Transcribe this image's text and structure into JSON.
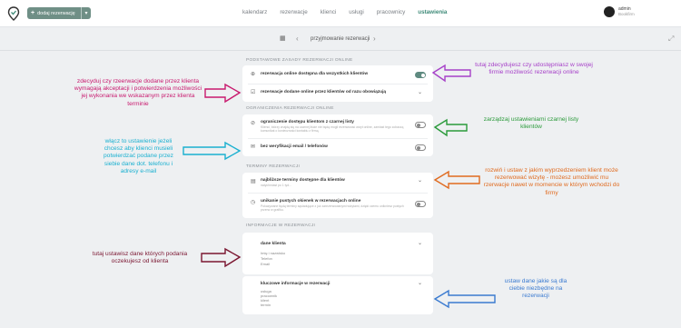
{
  "header": {
    "add_button_label": "dodaj rezerwację",
    "nav": [
      {
        "label": "kalendarz",
        "active": false
      },
      {
        "label": "rezerwacje",
        "active": false
      },
      {
        "label": "klienci",
        "active": false
      },
      {
        "label": "usługi",
        "active": false
      },
      {
        "label": "pracownicy",
        "active": false
      },
      {
        "label": "ustawienia",
        "active": true
      }
    ],
    "user_name": "admin",
    "user_company": "Bookfirm"
  },
  "subbar": {
    "title": "przyjmowanie rezerwacji"
  },
  "sections": {
    "basic": {
      "heading": "PODSTAWOWE ZASADY REZERWACJI ONLINE",
      "row1_label": "rezerwacja online dostępna dla wszystkich klientów",
      "row2_label": "rezerwacje dodane online przez klientów od razu obowiązują"
    },
    "restrictions": {
      "heading": "OGRANICZENIA REZERWACJI ONLINE",
      "row1_label": "ograniczenie dostępu klientom z czarnej listy",
      "row1_desc": "Klienci, którzy znajdą się na czarnej liście nie będą mogli rezerwować wizyt online, zamiast tego zobaczą komunikat o konieczności kontaktu z firmą.",
      "row2_label": "bez weryfikacji email / telefonów"
    },
    "terms": {
      "heading": "TERMINY REZERWACJI",
      "row1_label": "najbliższe terminy dostępne dla klientów",
      "row1_desc": "natychmiast po 1 tyd...",
      "row2_label": "unikanie pustych okienek w rezerwacjach online",
      "row2_desc": "Pokazywane będą terminy sąsiadujące z już zarezerwowanymi wizytami, dzięki czemu unikniesz pustych przerw w grafiku."
    },
    "info": {
      "heading": "INFORMACJE W REZERWACJI",
      "client_data_label": "dane klienta",
      "client_data_items": [
        "Imię i nazwisko",
        "Telefon",
        "Email"
      ],
      "key_info_label": "kluczowe informacje w rezerwacji",
      "key_info_items": [
        "usługa",
        "pracownik",
        "klient",
        "termin"
      ]
    }
  },
  "annotations": {
    "a1": "tutaj zdecydujesz czy udostępniasz w swojej firmie możliwość rezerwacji online",
    "a2": "zdecyduj czy rzeerwacje dodane przez klienta wymagają akceptacji i potwierdzenia możliwości jej wykonania we wskazanym przez klienta terminie",
    "a3": "zarządzaj ustawieniami czarnej listy klientów",
    "a4": "włącz to ustawienie jeżeli chcesz aby klienci musieli potwierdzać podane przez siebie dane dot. telefonu i adresy e-mail",
    "a5": "rozwiń i ustaw z jakim wyprzedzeniem klient może rezerwować wizytę - możesz umożliwić mu rzerwacje nawet w momencie w którym wchodzi do firmy",
    "a6": "tutaj ustawisz dane których podania oczekujesz od klienta",
    "a7": "ustaw dane jakie są dla ciebie niezbędne na rezerwacji"
  },
  "colors": {
    "accent": "#3e8a78",
    "magenta": "#c8196e",
    "purple": "#a640c8",
    "green": "#2a9a3a",
    "cyan": "#1ab0d0",
    "orange": "#e06a1e",
    "maroon": "#7a1530",
    "blue": "#3a7ad0"
  }
}
